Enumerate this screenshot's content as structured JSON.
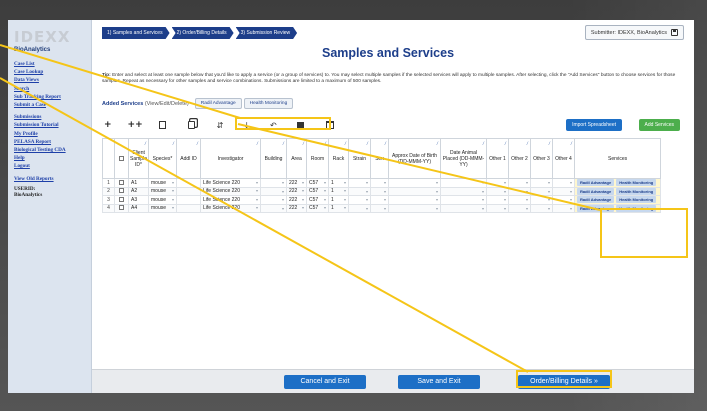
{
  "sidebar": {
    "logo": "IDEXX",
    "logo_sub": "BioAnalytics",
    "links": [
      "Case List",
      "Case Lookup",
      "Data Views",
      "Search",
      "Sub Tracking Report",
      "Submit a Case"
    ],
    "links2": [
      "Submissions",
      "Submission Tutorial",
      "My Profile",
      "PELASA Report",
      "Biological Testing CDA",
      "Help",
      "Logout"
    ],
    "links3": [
      "View Old Reports"
    ],
    "user_label": "USERID:",
    "user_value": "BioAnalytics"
  },
  "steps": [
    "1) Samples and Services",
    "2) Order/Billing Details",
    "3) Submission Review"
  ],
  "submitter": "Submitter: IDEXX, BioAnalytics",
  "page_title": "Samples and Services",
  "tip": {
    "bold": "Tip:",
    "text": "Enter and select at least one sample below that you'd like to apply a service (or a group of services) to. You may select multiple samples if the selected services will apply to multiple samples. After selecting, click the \"Add Services\" button to choose services for those samples. Repeat as necessary for other samples and service combinations. Submissions are limited to a maximum of 500 samples."
  },
  "added_services": {
    "label": "Added Services",
    "sub": "(View/Edit/Delete)",
    "tabs": [
      "Radil Advantage",
      "Health Monitoring"
    ]
  },
  "toolbar": {
    "add_one": "+",
    "add_many": "++",
    "import": "Import Spreadsheet",
    "add_services": "Add Services"
  },
  "table": {
    "headers": [
      "",
      "",
      "Client Sample ID*",
      "Species*",
      "Addl ID",
      "Investigator",
      "Building",
      "Area",
      "Room",
      "Rack",
      "Strain",
      "Sex",
      "Approx Date of Birth (DD-MMM-YY)",
      "Date Animal Placed (DD-MMM-YY)",
      "Other 1",
      "Other 2",
      "Other 3",
      "Other 4",
      "Services"
    ],
    "rows": [
      {
        "num": "1",
        "sample": "A1",
        "species": "mouse",
        "investigator": "Life Science 220",
        "area": "222",
        "room": "C57",
        "rack": "1"
      },
      {
        "num": "2",
        "sample": "A2",
        "species": "mouse",
        "investigator": "Life Science 220",
        "area": "222",
        "room": "C57",
        "rack": "1"
      },
      {
        "num": "3",
        "sample": "A3",
        "species": "mouse",
        "investigator": "Life Science 220",
        "area": "222",
        "room": "C57",
        "rack": "1"
      },
      {
        "num": "4",
        "sample": "A4",
        "species": "mouse",
        "investigator": "Life Science 220",
        "area": "222",
        "room": "C57",
        "rack": "1"
      }
    ],
    "service_pills": [
      "Radil Advantage",
      "Health Monitoring"
    ]
  },
  "bottom": {
    "cancel": "Cancel and Exit",
    "save": "Save and Exit",
    "next": "Order/Billing Details »"
  },
  "colors": {
    "brand_navy": "#1d3e8a",
    "button_blue": "#1d6fc6",
    "add_green": "#4cae4c",
    "highlight_yellow": "#f5c518"
  }
}
